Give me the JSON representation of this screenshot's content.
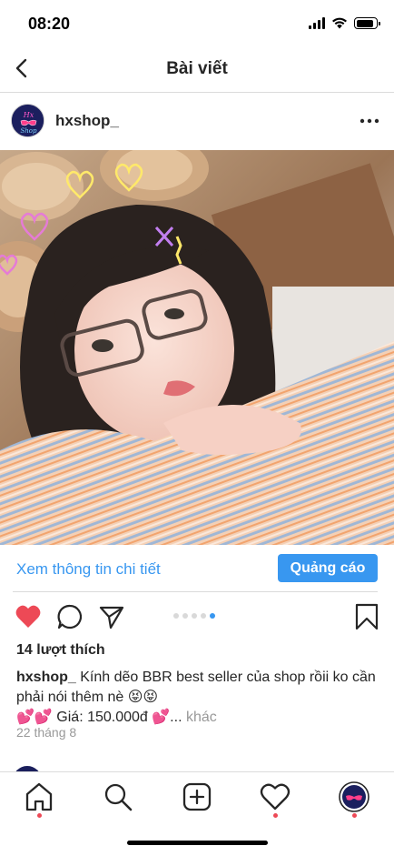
{
  "status_bar": {
    "time": "08:20",
    "icons": [
      "cellular-signal-icon",
      "wifi-icon",
      "battery-icon"
    ],
    "battery_level": 0.9
  },
  "header": {
    "title": "Bài viết",
    "back_icon": "chevron-left-icon"
  },
  "post": {
    "username": "hxshop_",
    "avatar_text": "Hx Shop",
    "more_icon": "more-horizontal-icon",
    "cta_text": "Xem thông tin chi tiết",
    "ad_button": "Quảng cáo",
    "carousel": {
      "count": 5,
      "active_index": 4
    },
    "likes": "14 lượt thích",
    "caption_user": "hxshop_",
    "caption_text": "Kính dẽo BBR best seller của shop rồii ko cần phải nói thêm nè 😝😝",
    "caption_line2": "💕💕 Giá: 150.000đ 💕...",
    "caption_more": "khác",
    "date": "22 tháng 8",
    "liked": true
  },
  "tab_bar": {
    "tabs": [
      "home-icon",
      "search-icon",
      "add-post-icon",
      "activity-heart-icon",
      "profile-avatar"
    ]
  },
  "colors": {
    "accent": "#3897f0",
    "like_red": "#ed4956",
    "text": "#262626",
    "muted": "#999999"
  }
}
